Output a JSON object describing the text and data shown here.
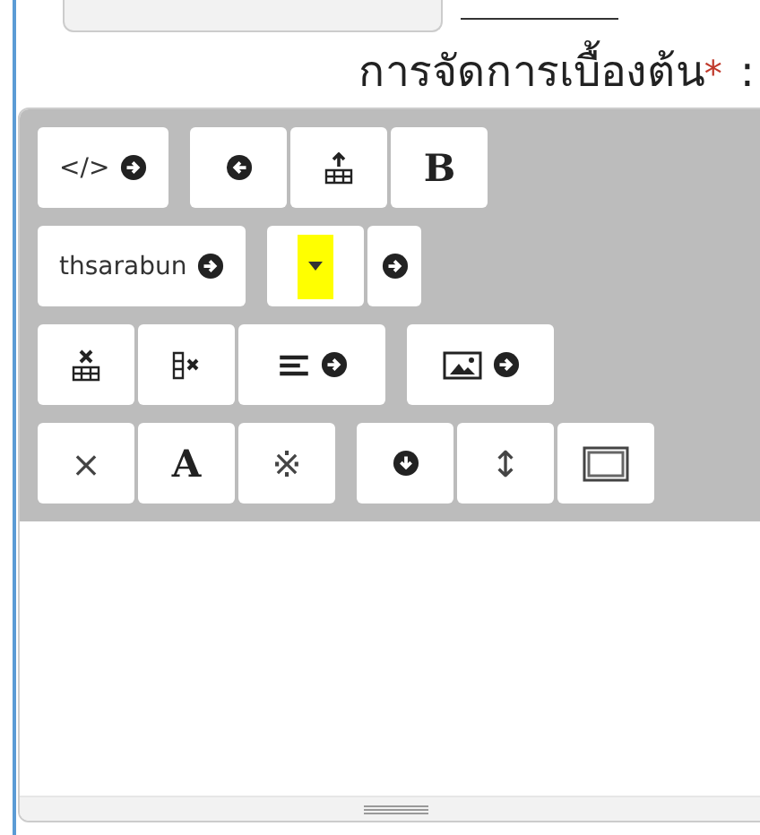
{
  "label": {
    "text": "การจัดการเบื้องต้น",
    "required_mark": "*",
    "colon": ":"
  },
  "toolbar": [
    [
      [
        {
          "kind": "text-arrow",
          "label": "</>"
        }
      ],
      [
        {
          "kind": "back"
        },
        {
          "kind": "table-add"
        },
        {
          "kind": "bold",
          "label": "B"
        }
      ]
    ],
    [
      [
        {
          "kind": "text-arrow",
          "label": "thsarabun"
        }
      ],
      [
        {
          "kind": "swatch",
          "color": "#ffff00"
        },
        {
          "kind": "arrow"
        }
      ]
    ],
    [
      [
        {
          "kind": "table-del"
        },
        {
          "kind": "col-del"
        },
        {
          "kind": "align"
        }
      ],
      [
        {
          "kind": "image"
        }
      ]
    ],
    [
      [
        {
          "kind": "text",
          "label": "×"
        },
        {
          "kind": "serif",
          "label": "A"
        },
        {
          "kind": "text",
          "label": "※"
        }
      ],
      [
        {
          "kind": "down"
        },
        {
          "kind": "text",
          "label": "↕"
        },
        {
          "kind": "frame"
        }
      ]
    ]
  ]
}
